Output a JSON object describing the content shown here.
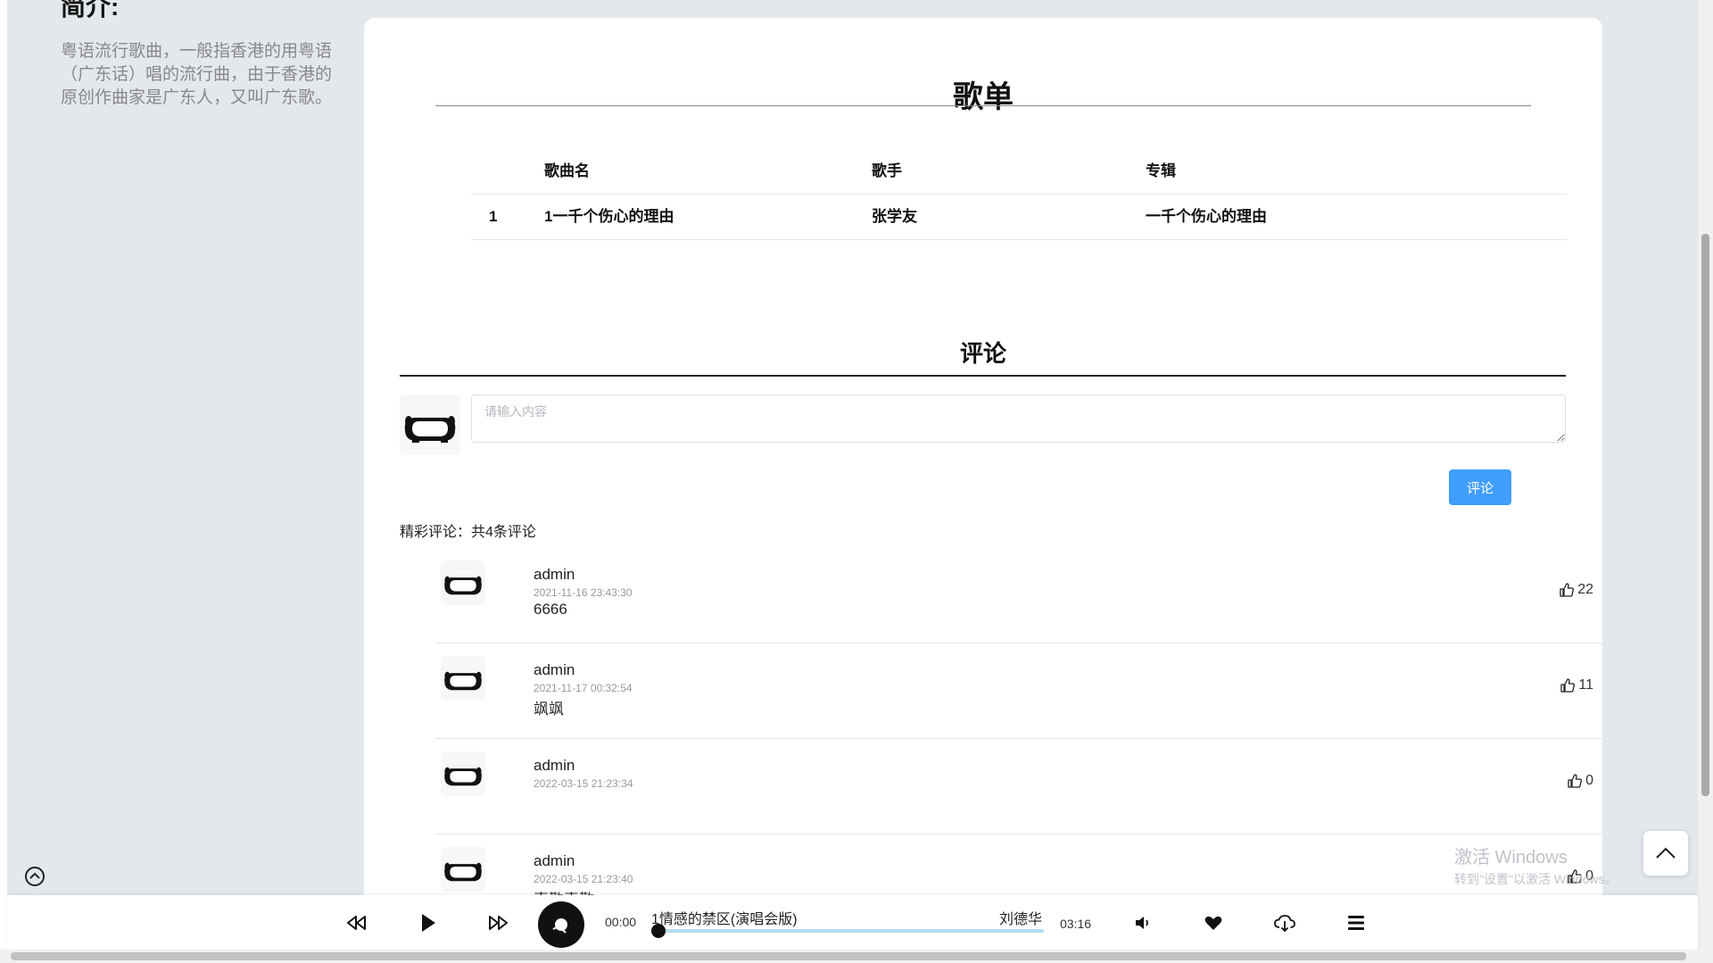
{
  "intro": {
    "title": "简介:",
    "text": "粤语流行歌曲，一般指香港的用粤语（广东话）唱的流行曲，由于香港的原创作曲家是广东人，又叫广东歌。"
  },
  "playlist": {
    "title": "歌单",
    "headers": {
      "index": "",
      "name": "歌曲名",
      "singer": "歌手",
      "album": "专辑"
    },
    "rows": [
      {
        "index": "1",
        "name": "1一千个伤心的理由",
        "singer": "张学友",
        "album": "一千个伤心的理由"
      }
    ]
  },
  "comments": {
    "title": "评论",
    "input_placeholder": "请输入内容",
    "submit_label": "评论",
    "count_text": "精彩评论：共4条评论",
    "items": [
      {
        "user": "admin",
        "time": "2021-11-16 23:43:30",
        "text": "6666",
        "likes": "22"
      },
      {
        "user": "admin",
        "time": "2021-11-17 00:32:54",
        "text": "飒飒",
        "likes": "11"
      },
      {
        "user": "admin",
        "time": "2022-03-15 21:23:34",
        "text": "",
        "likes": "0"
      },
      {
        "user": "admin",
        "time": "2022-03-15 21:23:40",
        "text": "喜歡喜歡",
        "likes": "0"
      }
    ]
  },
  "watermark": {
    "line1": "激活 Windows",
    "line2": "转到\"设置\"以激活 Windows。"
  },
  "player": {
    "current_time": "00:00",
    "song": "1情感的禁区(演唱会版)",
    "artist": "刘德华",
    "duration": "03:16",
    "progress": 0
  },
  "icons": {
    "prev": "rewind-icon",
    "play": "play-icon",
    "next": "fast-forward-icon",
    "volume": "volume-icon",
    "like": "heart-icon",
    "download": "cloud-download-icon",
    "list": "playlist-menu-icon",
    "thumb": "thumbs-up-icon"
  },
  "colors": {
    "accent": "#409eff",
    "progress_track": "#b7dcf3",
    "background": "#e3e8ed"
  }
}
